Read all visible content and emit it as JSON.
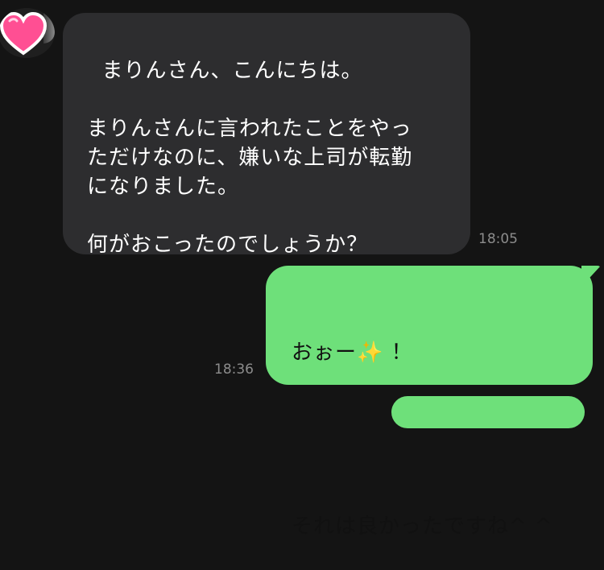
{
  "chat": {
    "incoming": {
      "text": "まりんさん、こんにちは。\n\nまりんさんに言われたことをやっ\nただけなのに、嫌いな上司が転勤\nになりました。\n\n何がおこったのでしょうか？",
      "time": "18:05"
    },
    "outgoing": {
      "line1_before": "おぉー",
      "emoji": "✨",
      "line1_after": " ！",
      "line2": "それは良かったですね^ ^",
      "time": "18:36"
    }
  },
  "colors": {
    "background": "#141414",
    "incoming_bubble": "#2d2d2f",
    "outgoing_bubble": "#6ee07a",
    "timestamp": "#8c8c8c",
    "avatar_heart": "#ff4f93"
  },
  "icons": {
    "avatar": "pink-heart-icon"
  }
}
